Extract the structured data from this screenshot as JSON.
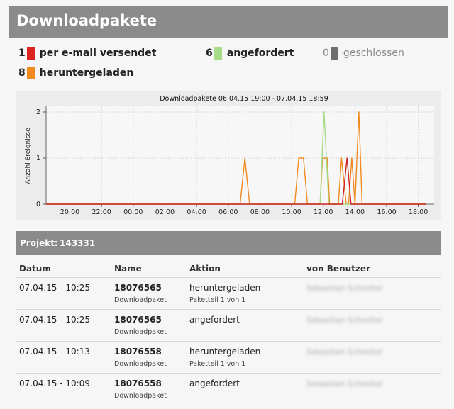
{
  "title": "Downloadpakete",
  "stats": [
    {
      "count": "1",
      "label": "per e-mail versendet",
      "color": "#dd2222"
    },
    {
      "count": "6",
      "label": "angefordert",
      "color": "#a6db88"
    },
    {
      "count": "0",
      "label": "geschlossen",
      "color": "#6f6f6f"
    },
    {
      "count": "8",
      "label": "heruntergeladen",
      "color": "#f08a1e"
    }
  ],
  "chart_data": {
    "type": "line",
    "title": "Downloadpakete 06.04.15 19:00 - 07.04.15 18:59",
    "xlabel": "",
    "ylabel": "Anzahl Ereignisse",
    "ylim": [
      0,
      2
    ],
    "x_ticks": [
      "20:00",
      "22:00",
      "00:00",
      "02:00",
      "04:00",
      "06:00",
      "08:00",
      "10:00",
      "12:00",
      "14:00",
      "16:00",
      "18:00"
    ],
    "y_ticks": [
      "0",
      "1",
      "2"
    ],
    "x_range_hours": [
      18.5,
      43.0
    ],
    "grid": true,
    "series": [
      {
        "color": "#f08a1e",
        "points": [
          [
            18.5,
            0
          ],
          [
            30.75,
            0
          ],
          [
            31.05,
            1
          ],
          [
            31.35,
            0
          ],
          [
            34.2,
            0
          ],
          [
            34.45,
            1
          ],
          [
            34.75,
            1
          ],
          [
            35.0,
            0
          ],
          [
            35.8,
            0
          ],
          [
            35.95,
            1
          ],
          [
            36.25,
            1
          ],
          [
            36.4,
            0
          ],
          [
            36.95,
            0
          ],
          [
            37.15,
            1
          ],
          [
            37.45,
            0
          ],
          [
            37.6,
            0
          ],
          [
            37.8,
            1
          ],
          [
            38.0,
            0
          ],
          [
            38.25,
            2
          ],
          [
            38.45,
            0
          ],
          [
            42.5,
            0
          ]
        ]
      },
      {
        "color": "#a6db88",
        "points": [
          [
            18.5,
            0
          ],
          [
            35.8,
            0
          ],
          [
            36.05,
            2
          ],
          [
            36.35,
            0
          ],
          [
            42.5,
            0
          ]
        ]
      },
      {
        "color": "#cc2222",
        "points": [
          [
            18.5,
            0
          ],
          [
            37.2,
            0
          ],
          [
            37.5,
            1
          ],
          [
            37.75,
            0
          ],
          [
            42.5,
            0
          ]
        ]
      }
    ]
  },
  "project": {
    "label": "Projekt:",
    "value": "143331"
  },
  "table": {
    "headers": [
      "Datum",
      "Name",
      "Aktion",
      "von Benutzer"
    ],
    "rows": [
      {
        "datum": "07.04.15 - 10:25",
        "name": "18076565",
        "name_sub": "Downloadpaket",
        "aktion": "heruntergeladen",
        "aktion_sub": "Paketteil 1 von 1",
        "user": "Sebastian Schreiter"
      },
      {
        "datum": "07.04.15 - 10:25",
        "name": "18076565",
        "name_sub": "Downloadpaket",
        "aktion": "angefordert",
        "aktion_sub": "",
        "user": "Sebastian Schreiter"
      },
      {
        "datum": "07.04.15 - 10:13",
        "name": "18076558",
        "name_sub": "Downloadpaket",
        "aktion": "heruntergeladen",
        "aktion_sub": "Paketteil 1 von 1",
        "user": "Sebastian Schreiter"
      },
      {
        "datum": "07.04.15 - 10:09",
        "name": "18076558",
        "name_sub": "Downloadpaket",
        "aktion": "angefordert",
        "aktion_sub": "",
        "user": "Sebastian Schreiter"
      }
    ]
  }
}
